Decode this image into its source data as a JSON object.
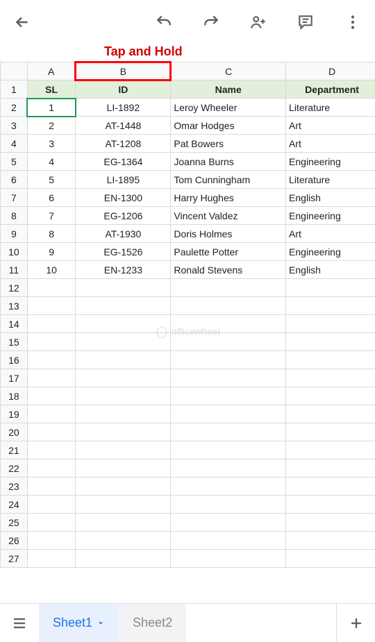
{
  "annotation": "Tap and Hold",
  "columns": [
    "A",
    "B",
    "C",
    "D"
  ],
  "headers": {
    "A": "SL",
    "B": "ID",
    "C": "Name",
    "D": "Department"
  },
  "rows": [
    {
      "sl": "1",
      "id": "LI-1892",
      "name": "Leroy Wheeler",
      "dept": "Literature"
    },
    {
      "sl": "2",
      "id": "AT-1448",
      "name": "Omar Hodges",
      "dept": "Art"
    },
    {
      "sl": "3",
      "id": "AT-1208",
      "name": "Pat Bowers",
      "dept": "Art"
    },
    {
      "sl": "4",
      "id": "EG-1364",
      "name": "Joanna Burns",
      "dept": "Engineering"
    },
    {
      "sl": "5",
      "id": "LI-1895",
      "name": "Tom Cunningham",
      "dept": "Literature"
    },
    {
      "sl": "6",
      "id": "EN-1300",
      "name": "Harry Hughes",
      "dept": "English"
    },
    {
      "sl": "7",
      "id": "EG-1206",
      "name": "Vincent Valdez",
      "dept": "Engineering"
    },
    {
      "sl": "8",
      "id": "AT-1930",
      "name": "Doris Holmes",
      "dept": "Art"
    },
    {
      "sl": "9",
      "id": "EG-1526",
      "name": "Paulette Potter",
      "dept": "Engineering"
    },
    {
      "sl": "10",
      "id": "EN-1233",
      "name": "Ronald Stevens",
      "dept": "English"
    }
  ],
  "empty_rows_start": 12,
  "empty_rows_end": 27,
  "tabs": {
    "active": "Sheet1",
    "inactive": "Sheet2"
  },
  "icons": {
    "back": "back-arrow-icon",
    "undo": "undo-icon",
    "redo": "redo-icon",
    "share": "share-person-icon",
    "comment": "comment-icon",
    "more": "more-vert-icon",
    "menu": "menu-icon",
    "dropdown": "dropdown-icon",
    "add": "plus-icon"
  }
}
